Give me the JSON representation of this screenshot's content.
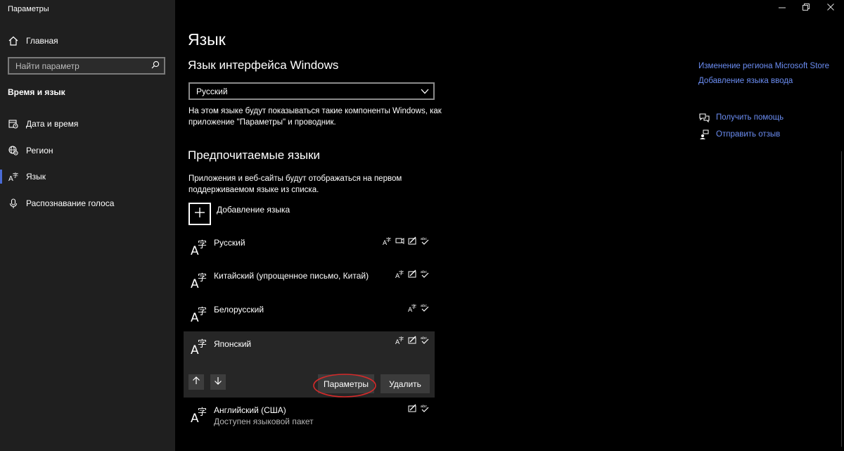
{
  "window": {
    "title": "Параметры"
  },
  "sidebar": {
    "home_label": "Главная",
    "search_placeholder": "Найти параметр",
    "section_title": "Время и язык",
    "items": [
      {
        "label": "Дата и время",
        "icon": "calendar-clock-icon"
      },
      {
        "label": "Регион",
        "icon": "globe-gear-icon"
      },
      {
        "label": "Язык",
        "icon": "language-icon",
        "active": true
      },
      {
        "label": "Распознавание голоса",
        "icon": "microphone-icon"
      }
    ]
  },
  "main": {
    "title": "Язык",
    "display_language": {
      "heading": "Язык интерфейса Windows",
      "selected": "Русский",
      "description": "На этом языке будут показываться такие компоненты Windows, как приложение \"Параметры\" и проводник."
    },
    "preferred": {
      "heading": "Предпочитаемые языки",
      "description": "Приложения и веб-сайты будут отображаться на первом поддерживаемом языке из списка.",
      "add_label": "Добавление языка",
      "languages": [
        {
          "name": "Русский",
          "features": [
            "display-language",
            "speech",
            "handwriting",
            "spelling"
          ]
        },
        {
          "name": "Китайский (упрощенное письмо, Китай)",
          "features": [
            "display-language",
            "handwriting",
            "spelling"
          ]
        },
        {
          "name": "Белорусский",
          "features": [
            "display-language",
            "spelling"
          ]
        },
        {
          "name": "Японский",
          "features": [
            "display-language",
            "handwriting",
            "spelling"
          ],
          "selected": true
        },
        {
          "name": "Английский (США)",
          "sub": "Доступен языковой пакет",
          "features": [
            "handwriting",
            "spelling"
          ]
        }
      ],
      "options_label": "Параметры",
      "remove_label": "Удалить"
    }
  },
  "related": {
    "links": [
      "Изменение региона Microsoft Store",
      "Добавление языка ввода"
    ],
    "help_label": "Получить помощь",
    "feedback_label": "Отправить отзыв"
  },
  "colors": {
    "accent": "#4a6bd6",
    "link": "#6b8df2",
    "annotation": "#d42a2a"
  }
}
